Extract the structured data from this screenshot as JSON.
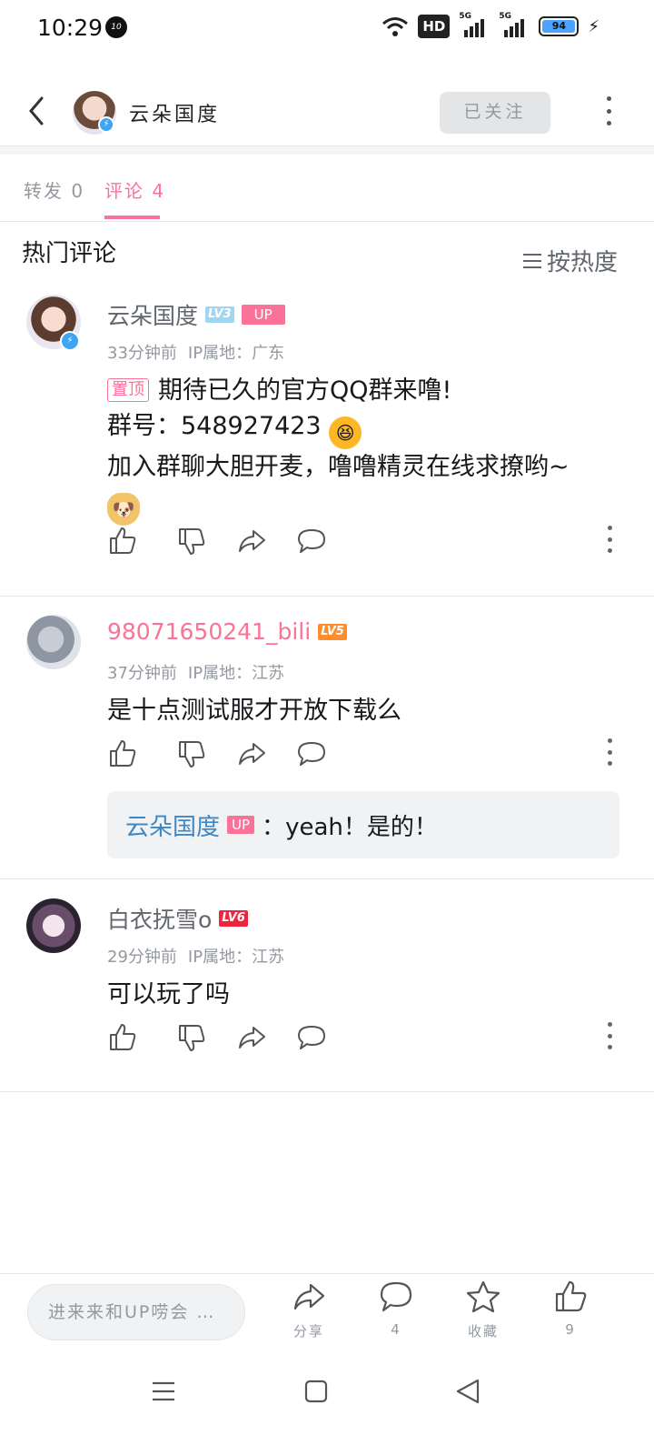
{
  "status_bar": {
    "time": "10:29",
    "notification_badge": "10",
    "network_hd": "HD",
    "signal1_label": "5G",
    "signal2_label": "5G",
    "battery_level": "94"
  },
  "header": {
    "name": "云朵国度",
    "follow_label": "已关注"
  },
  "tabs": {
    "repost_label": "转发 0",
    "comment_label": "评论 4"
  },
  "section": {
    "title": "热门评论",
    "sort_label": "按热度"
  },
  "comments": [
    {
      "user": "云朵国度",
      "level": "LV3",
      "up_badge": "UP",
      "time": "33分钟前",
      "ip": "IP属地：广东",
      "pin_label": "置顶",
      "lines": [
        "期待已久的官方QQ群来噜!",
        "群号：548927423",
        "加入群聊大胆开麦，噜噜精灵在线求撩哟~"
      ],
      "emoji_1": "laughing-emoji",
      "emoji_2": "dog-with-rose-emoji"
    },
    {
      "user": "98071650241_bili",
      "level": "LV5",
      "time": "37分钟前",
      "ip": "IP属地：江苏",
      "text": "是十点测试服才开放下载么",
      "reply": {
        "user": "云朵国度",
        "up_badge": "UP",
        "separator": "：",
        "text": "yeah！是的！"
      }
    },
    {
      "user": "白衣抚雪o",
      "level": "LV6",
      "time": "29分钟前",
      "ip": "IP属地：江苏",
      "text": "可以玩了吗"
    }
  ],
  "bottom_bar": {
    "input_placeholder": "进来来和UP唠会 …",
    "share_label": "分享",
    "comment_count": "4",
    "favorite_label": "收藏",
    "like_count": "9"
  },
  "colors": {
    "accent_pink": "#fb7299",
    "link_blue": "#3b88c8",
    "muted_gray": "#9499a0"
  },
  "icons": [
    "back-icon",
    "more-vertical-icon",
    "like-icon",
    "dislike-icon",
    "share-icon",
    "reply-icon",
    "star-icon",
    "menu-icon",
    "home-icon",
    "back-triangle-icon"
  ]
}
